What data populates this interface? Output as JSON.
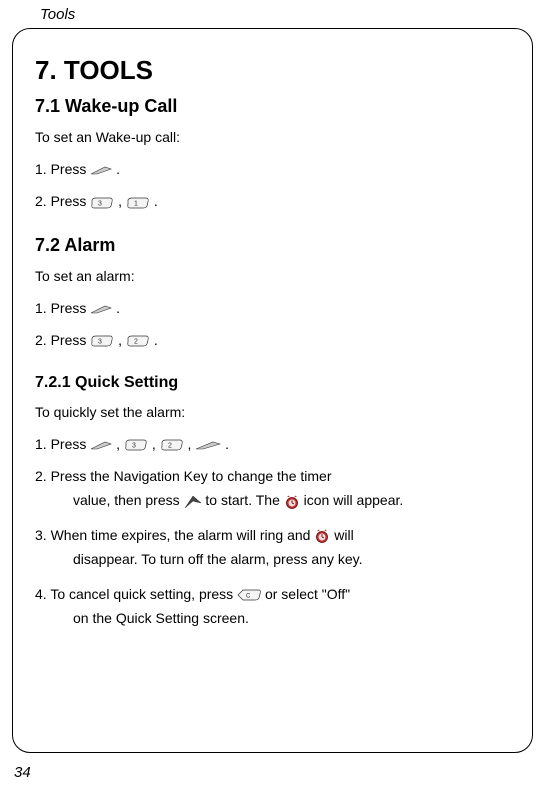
{
  "header": {
    "title": "Tools"
  },
  "main": {
    "h1": "7. TOOLS",
    "section1": {
      "h2": "7.1 Wake-up Call",
      "intro": "To set an Wake-up call:",
      "step1_a": "1.  Press ",
      "step1_b": ".",
      "step2_a": "2.  Press  ",
      "step2_b": ", ",
      "step2_c": "."
    },
    "section2": {
      "h2": "7.2 Alarm",
      "intro": "To set an alarm:",
      "step1_a": "1.  Press ",
      "step1_b": ".",
      "step2_a": "2.  Press  ",
      "step2_b": ", ",
      "step2_c": "."
    },
    "section3": {
      "h3": "7.2.1 Quick Setting",
      "intro": "To quickly set the alarm:",
      "step1_a": "1.  Press ",
      "step1_b": ", ",
      "step1_c": ", ",
      "step1_d": ", ",
      "step1_e": ".",
      "step2_a": "2. Press the Navigation Key to change the timer",
      "step2_b": "value, then press ",
      "step2_c": " to start. The ",
      "step2_d": " icon will appear.",
      "step3_a": "3.  When time expires, the alarm will ring and ",
      "step3_b": " will",
      "step3_c": "disappear. To turn off the alarm, press any key.",
      "step4_a": "4. To cancel quick setting, press ",
      "step4_b": " or select \"Off\"",
      "step4_c": "on the Quick Setting screen."
    }
  },
  "page_number": "34"
}
